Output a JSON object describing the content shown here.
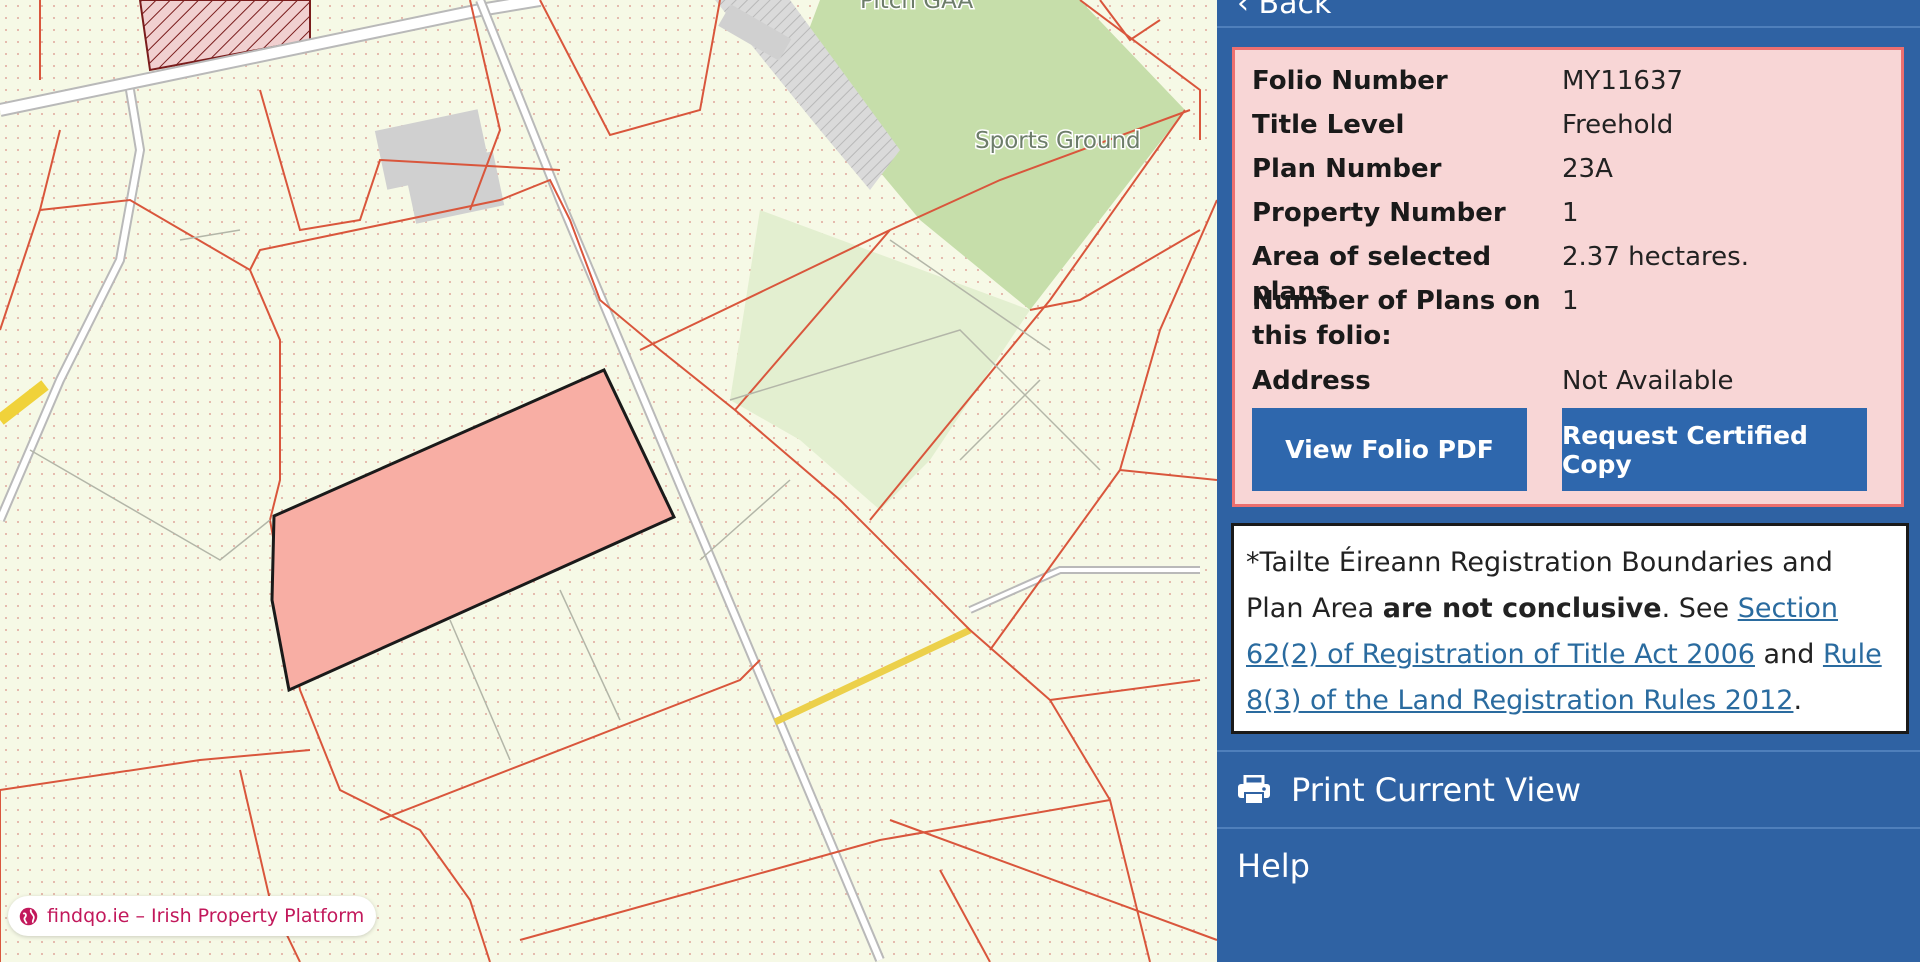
{
  "map": {
    "labels": {
      "pitch": "Pitch GAA",
      "sports_ground": "Sports Ground"
    },
    "brand": "findqo.ie – Irish Property Platform",
    "brand_color": "#c2185b",
    "selected_parcel_color": "#f8aea4",
    "boundary_color": "#d9563c"
  },
  "panel": {
    "back_label": "‹ Back",
    "folio": {
      "rows": [
        {
          "label": "Folio Number",
          "value": "MY11637"
        },
        {
          "label": "Title Level",
          "value": "Freehold"
        },
        {
          "label": "Plan Number",
          "value": "23A"
        },
        {
          "label": "Property Number",
          "value": "1"
        },
        {
          "label": "Area of selected plans",
          "value": "2.37 hectares."
        },
        {
          "label": "Number of Plans on this folio:",
          "value": "1"
        },
        {
          "label": "Address",
          "value": "Not Available"
        }
      ],
      "view_pdf": "View Folio PDF",
      "request_copy": "Request Certified Copy"
    },
    "disclaimer": {
      "prefix": "*Tailte Éireann Registration Boundaries and Plan Area ",
      "bold": "are not conclusive",
      "mid": ". See ",
      "link1": "Section 62(2) of Registration of Title Act 2006",
      "and": " and ",
      "link2": "Rule 8(3) of the Land Registration Rules 2012",
      "end": "."
    },
    "print_label": "Print Current View",
    "help_label": "Help",
    "accent_color": "#2f62a3"
  }
}
